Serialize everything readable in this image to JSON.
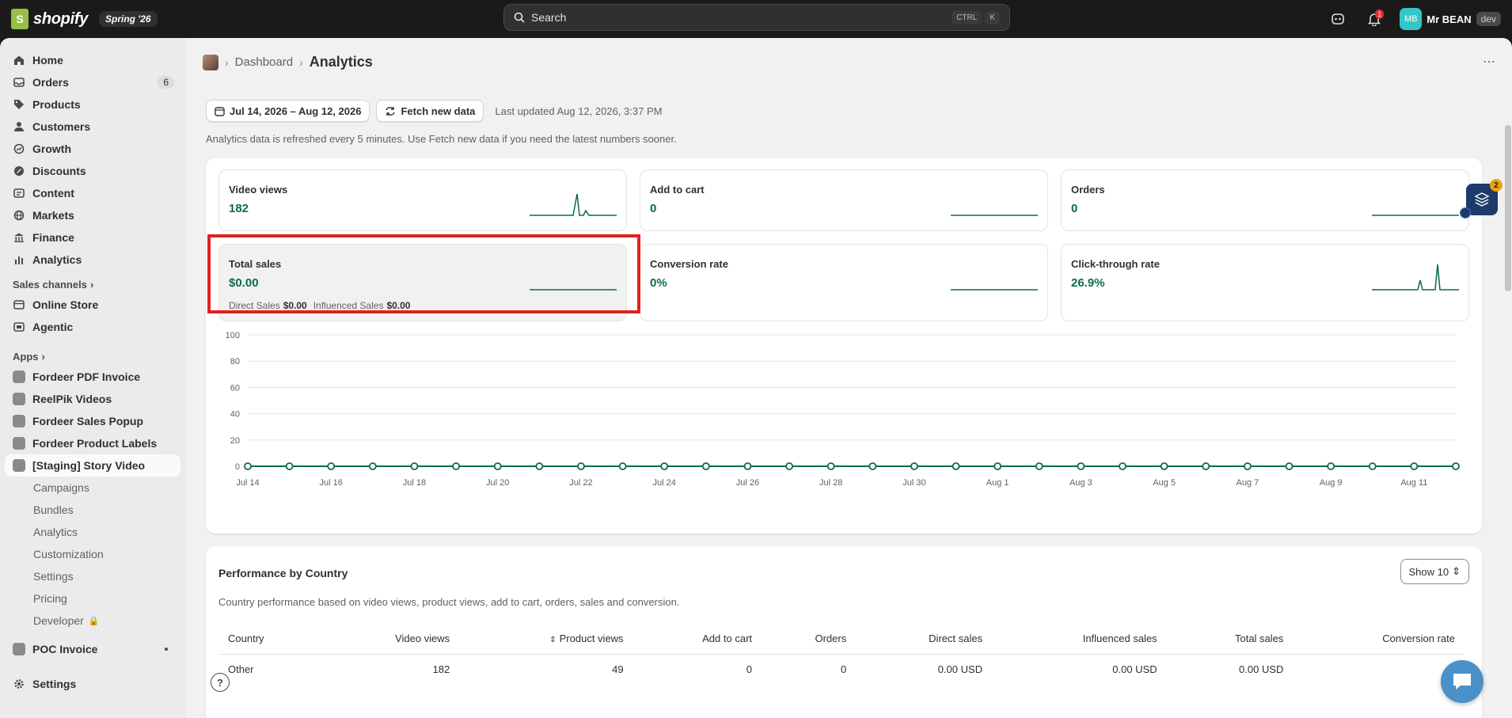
{
  "topbar": {
    "brand": "shopify",
    "edition": "Spring '26",
    "search_placeholder": "Search",
    "kbd": [
      "CTRL",
      "K"
    ],
    "notif_count": "1",
    "user_initials": "MB",
    "user_name": "Mr BEAN",
    "store_badge": "dev"
  },
  "sidebar": {
    "main_items": [
      {
        "label": "Home",
        "icon": "home-icon"
      },
      {
        "label": "Orders",
        "icon": "inbox-icon",
        "count": "6"
      },
      {
        "label": "Products",
        "icon": "tag-icon"
      },
      {
        "label": "Customers",
        "icon": "person-icon"
      },
      {
        "label": "Growth",
        "icon": "growth-icon"
      },
      {
        "label": "Discounts",
        "icon": "discount-icon"
      },
      {
        "label": "Content",
        "icon": "content-icon"
      },
      {
        "label": "Markets",
        "icon": "globe-icon"
      },
      {
        "label": "Finance",
        "icon": "bank-icon"
      },
      {
        "label": "Analytics",
        "icon": "bar-chart-icon"
      }
    ],
    "sales_channels_label": "Sales channels",
    "channels": [
      {
        "label": "Online Store",
        "icon": "store-icon"
      },
      {
        "label": "Agentic",
        "icon": "agentic-icon"
      }
    ],
    "apps_label": "Apps",
    "apps": [
      {
        "label": "Fordeer PDF Invoice"
      },
      {
        "label": "ReelPik Videos"
      },
      {
        "label": "Fordeer Sales Popup"
      },
      {
        "label": "Fordeer Product Labels"
      },
      {
        "label": "[Staging] Story Video"
      }
    ],
    "sub_items": [
      "Campaigns",
      "Bundles",
      "Analytics",
      "Customization",
      "Settings",
      "Pricing",
      "Developer"
    ],
    "poc_label": "POC Invoice",
    "settings_label": "Settings"
  },
  "page": {
    "breadcrumb_link": "Dashboard",
    "title": "Analytics",
    "date_range": "Jul 14, 2026 – Aug 12, 2026",
    "fetch_label": "Fetch new data",
    "last_updated": "Last updated Aug 12, 2026, 3:37 PM",
    "refresh_note": "Analytics data is refreshed every 5 minutes. Use Fetch new data if you need the latest numbers sooner."
  },
  "metrics": [
    {
      "label": "Video views",
      "value": "182"
    },
    {
      "label": "Add to cart",
      "value": "0"
    },
    {
      "label": "Orders",
      "value": "0"
    },
    {
      "label": "Total sales",
      "value": "$0.00",
      "direct_label": "Direct Sales",
      "direct_value": "$0.00",
      "influenced_label": "Influenced Sales",
      "influenced_value": "$0.00"
    },
    {
      "label": "Conversion rate",
      "value": "0%"
    },
    {
      "label": "Click-through rate",
      "value": "26.9%"
    }
  ],
  "chart_data": {
    "type": "line",
    "y_ticks": [
      "0",
      "20",
      "40",
      "60",
      "80",
      "100"
    ],
    "ylim": [
      0,
      100
    ],
    "x": [
      "Jul 14",
      "Jul 15",
      "Jul 16",
      "Jul 17",
      "Jul 18",
      "Jul 19",
      "Jul 20",
      "Jul 21",
      "Jul 22",
      "Jul 23",
      "Jul 24",
      "Jul 25",
      "Jul 26",
      "Jul 27",
      "Jul 28",
      "Jul 29",
      "Jul 30",
      "Jul 31",
      "Aug 1",
      "Aug 2",
      "Aug 3",
      "Aug 4",
      "Aug 5",
      "Aug 6",
      "Aug 7",
      "Aug 8",
      "Aug 9",
      "Aug 10",
      "Aug 11",
      "Aug 12"
    ],
    "x_tick_labels": [
      "Jul 14",
      "Jul 16",
      "Jul 18",
      "Jul 20",
      "Jul 22",
      "Jul 24",
      "Jul 26",
      "Jul 28",
      "Jul 30",
      "Aug 1",
      "Aug 3",
      "Aug 5",
      "Aug 7",
      "Aug 9",
      "Aug 11"
    ],
    "series": [
      {
        "values": [
          0,
          0,
          0,
          0,
          0,
          0,
          0,
          0,
          0,
          0,
          0,
          0,
          0,
          0,
          0,
          0,
          0,
          0,
          0,
          0,
          0,
          0,
          0,
          0,
          0,
          0,
          0,
          0,
          0,
          0
        ]
      }
    ],
    "color": "#0a6b4f",
    "grid": true
  },
  "performance": {
    "title": "Performance by Country",
    "show_label": "Show 10",
    "description": "Country performance based on video views, product views, add to cart, orders, sales and conversion.",
    "columns": [
      "Country",
      "Video views",
      "Product views",
      "Add to cart",
      "Orders",
      "Direct sales",
      "Influenced sales",
      "Total sales",
      "Conversion rate"
    ],
    "rows": [
      [
        "Other",
        "182",
        "49",
        "0",
        "0",
        "0.00 USD",
        "0.00 USD",
        "0.00 USD",
        ""
      ]
    ]
  },
  "widget_badge": "2",
  "help_label": "?"
}
